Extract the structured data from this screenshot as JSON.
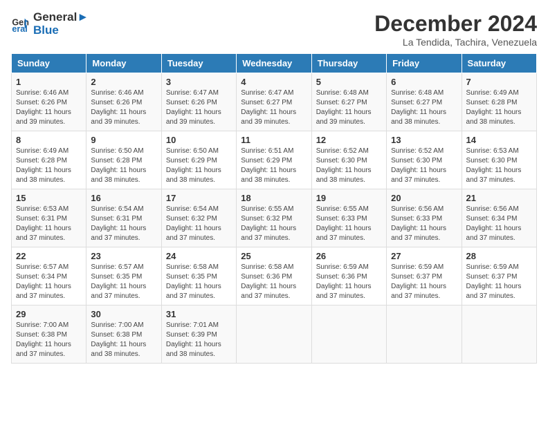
{
  "header": {
    "logo_line1": "General",
    "logo_line2": "Blue",
    "month": "December 2024",
    "location": "La Tendida, Tachira, Venezuela"
  },
  "weekdays": [
    "Sunday",
    "Monday",
    "Tuesday",
    "Wednesday",
    "Thursday",
    "Friday",
    "Saturday"
  ],
  "weeks": [
    [
      {
        "day": "1",
        "rise": "6:46 AM",
        "set": "6:26 PM",
        "daylight": "11 hours and 39 minutes."
      },
      {
        "day": "2",
        "rise": "6:46 AM",
        "set": "6:26 PM",
        "daylight": "11 hours and 39 minutes."
      },
      {
        "day": "3",
        "rise": "6:47 AM",
        "set": "6:26 PM",
        "daylight": "11 hours and 39 minutes."
      },
      {
        "day": "4",
        "rise": "6:47 AM",
        "set": "6:27 PM",
        "daylight": "11 hours and 39 minutes."
      },
      {
        "day": "5",
        "rise": "6:48 AM",
        "set": "6:27 PM",
        "daylight": "11 hours and 39 minutes."
      },
      {
        "day": "6",
        "rise": "6:48 AM",
        "set": "6:27 PM",
        "daylight": "11 hours and 38 minutes."
      },
      {
        "day": "7",
        "rise": "6:49 AM",
        "set": "6:28 PM",
        "daylight": "11 hours and 38 minutes."
      }
    ],
    [
      {
        "day": "8",
        "rise": "6:49 AM",
        "set": "6:28 PM",
        "daylight": "11 hours and 38 minutes."
      },
      {
        "day": "9",
        "rise": "6:50 AM",
        "set": "6:28 PM",
        "daylight": "11 hours and 38 minutes."
      },
      {
        "day": "10",
        "rise": "6:50 AM",
        "set": "6:29 PM",
        "daylight": "11 hours and 38 minutes."
      },
      {
        "day": "11",
        "rise": "6:51 AM",
        "set": "6:29 PM",
        "daylight": "11 hours and 38 minutes."
      },
      {
        "day": "12",
        "rise": "6:52 AM",
        "set": "6:30 PM",
        "daylight": "11 hours and 38 minutes."
      },
      {
        "day": "13",
        "rise": "6:52 AM",
        "set": "6:30 PM",
        "daylight": "11 hours and 37 minutes."
      },
      {
        "day": "14",
        "rise": "6:53 AM",
        "set": "6:30 PM",
        "daylight": "11 hours and 37 minutes."
      }
    ],
    [
      {
        "day": "15",
        "rise": "6:53 AM",
        "set": "6:31 PM",
        "daylight": "11 hours and 37 minutes."
      },
      {
        "day": "16",
        "rise": "6:54 AM",
        "set": "6:31 PM",
        "daylight": "11 hours and 37 minutes."
      },
      {
        "day": "17",
        "rise": "6:54 AM",
        "set": "6:32 PM",
        "daylight": "11 hours and 37 minutes."
      },
      {
        "day": "18",
        "rise": "6:55 AM",
        "set": "6:32 PM",
        "daylight": "11 hours and 37 minutes."
      },
      {
        "day": "19",
        "rise": "6:55 AM",
        "set": "6:33 PM",
        "daylight": "11 hours and 37 minutes."
      },
      {
        "day": "20",
        "rise": "6:56 AM",
        "set": "6:33 PM",
        "daylight": "11 hours and 37 minutes."
      },
      {
        "day": "21",
        "rise": "6:56 AM",
        "set": "6:34 PM",
        "daylight": "11 hours and 37 minutes."
      }
    ],
    [
      {
        "day": "22",
        "rise": "6:57 AM",
        "set": "6:34 PM",
        "daylight": "11 hours and 37 minutes."
      },
      {
        "day": "23",
        "rise": "6:57 AM",
        "set": "6:35 PM",
        "daylight": "11 hours and 37 minutes."
      },
      {
        "day": "24",
        "rise": "6:58 AM",
        "set": "6:35 PM",
        "daylight": "11 hours and 37 minutes."
      },
      {
        "day": "25",
        "rise": "6:58 AM",
        "set": "6:36 PM",
        "daylight": "11 hours and 37 minutes."
      },
      {
        "day": "26",
        "rise": "6:59 AM",
        "set": "6:36 PM",
        "daylight": "11 hours and 37 minutes."
      },
      {
        "day": "27",
        "rise": "6:59 AM",
        "set": "6:37 PM",
        "daylight": "11 hours and 37 minutes."
      },
      {
        "day": "28",
        "rise": "6:59 AM",
        "set": "6:37 PM",
        "daylight": "11 hours and 37 minutes."
      }
    ],
    [
      {
        "day": "29",
        "rise": "7:00 AM",
        "set": "6:38 PM",
        "daylight": "11 hours and 37 minutes."
      },
      {
        "day": "30",
        "rise": "7:00 AM",
        "set": "6:38 PM",
        "daylight": "11 hours and 38 minutes."
      },
      {
        "day": "31",
        "rise": "7:01 AM",
        "set": "6:39 PM",
        "daylight": "11 hours and 38 minutes."
      },
      null,
      null,
      null,
      null
    ]
  ]
}
